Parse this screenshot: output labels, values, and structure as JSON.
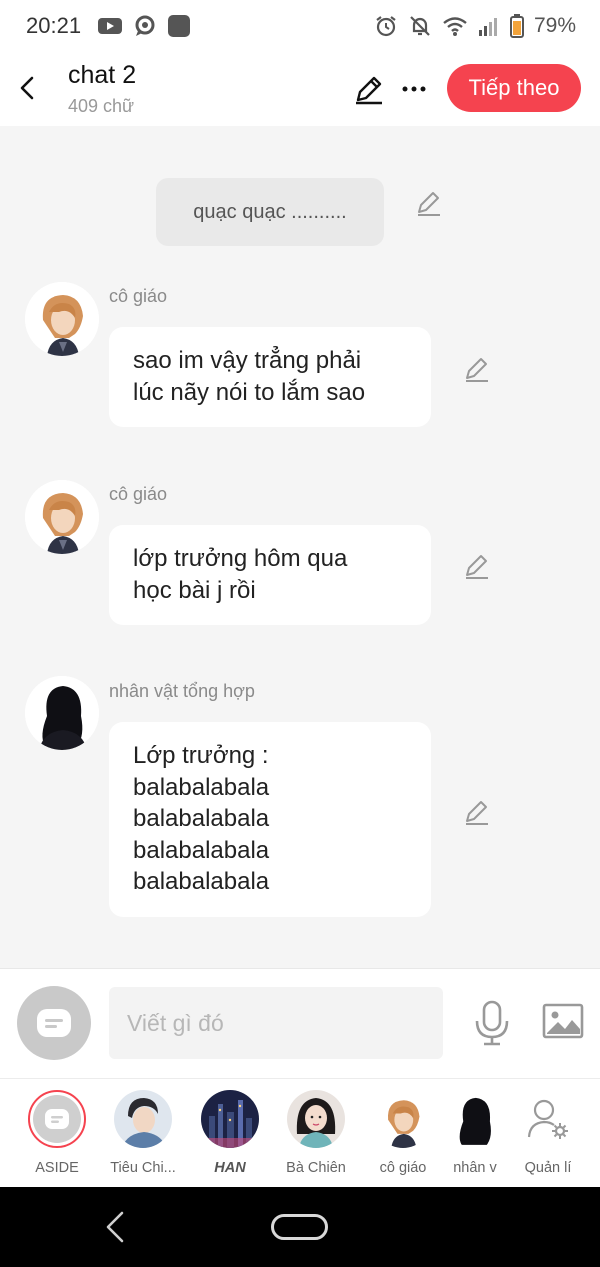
{
  "status": {
    "time": "20:21",
    "battery": "79%"
  },
  "header": {
    "title": "chat 2",
    "subtitle": "409 chữ",
    "next_label": "Tiếp theo"
  },
  "chat": {
    "narration": "quạc quạc ..........",
    "messages": [
      {
        "speaker": "cô giáo",
        "text": "sao im vậy trẳng phải\nlúc nãy nói to lắm sao"
      },
      {
        "speaker": "cô giáo",
        "text": "lớp trưởng hôm qua\nhọc bài j rồi"
      },
      {
        "speaker": "nhân vật tổng hợp",
        "text": "Lớp trưởng :\nbalabalabala\nbalabalabala\nbalabalabala\nbalabalabala"
      }
    ]
  },
  "input": {
    "placeholder": "Viết gì đó"
  },
  "characters": [
    {
      "name": "ASIDE"
    },
    {
      "name": "Tiêu Chi..."
    },
    {
      "name": "HAN"
    },
    {
      "name": "Bà Chiên"
    },
    {
      "name": "cô giáo"
    },
    {
      "name": "nhân v"
    },
    {
      "name": "Quản lí"
    }
  ],
  "colors": {
    "accent": "#f5434f",
    "background": "#f5f5f5"
  }
}
